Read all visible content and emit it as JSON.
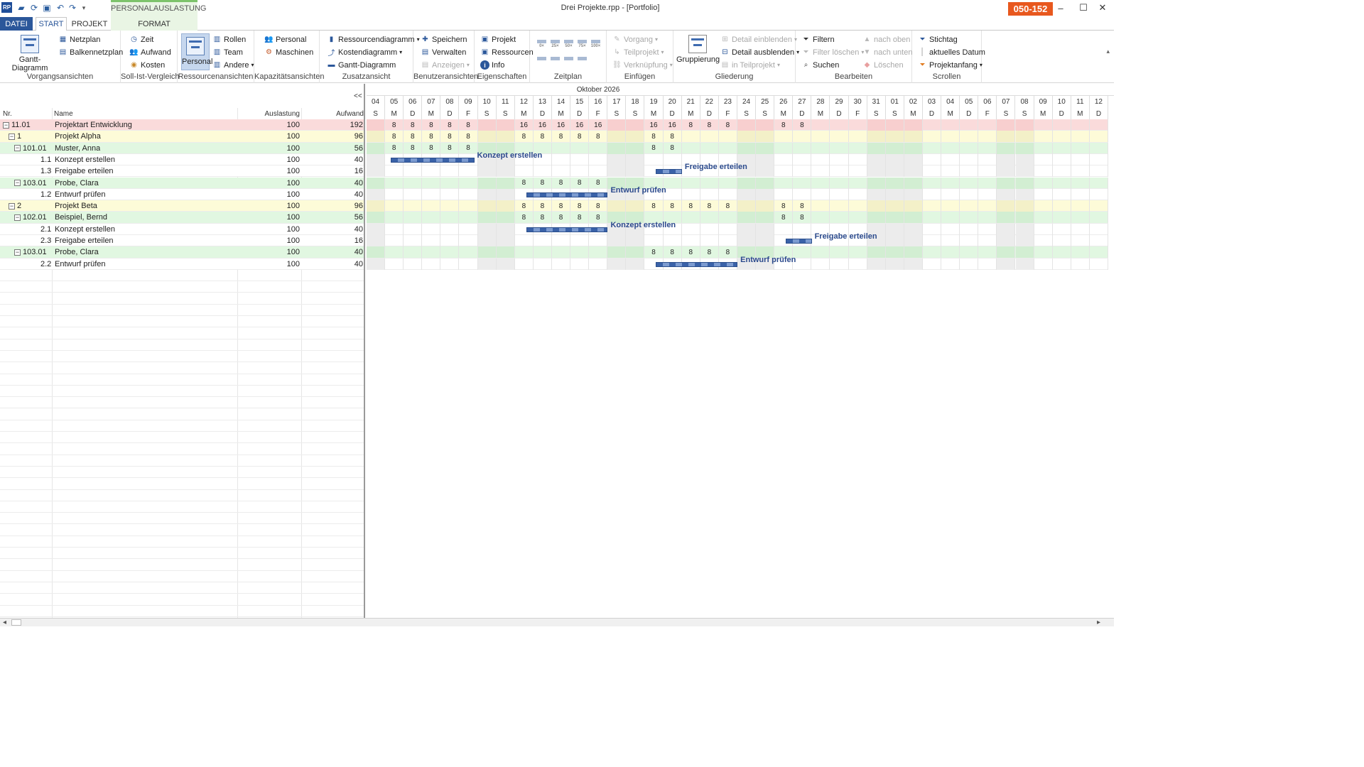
{
  "titlebar": {
    "logo": "RP",
    "window_title": "Drei Projekte.rpp - [Portfolio]",
    "context_group": "PERSONALAUSLASTUNG",
    "license_badge": "050-152",
    "minimize": "–",
    "maximize": "☐",
    "close": "✕"
  },
  "tabs": {
    "datei": "DATEI",
    "start": "START",
    "projekt": "PROJEKT",
    "format": "FORMAT"
  },
  "ribbon": {
    "vorgangsansichten": {
      "label": "Vorgangsansichten",
      "gantt": "Gantt-Diagramm",
      "netzplan": "Netzplan",
      "balkennetzplan": "Balkennetzplan"
    },
    "soll_ist": {
      "label": "Soll-Ist-Vergleich",
      "zeit": "Zeit",
      "aufwand": "Aufwand",
      "kosten": "Kosten"
    },
    "ressourcenansichten": {
      "label": "Ressourcenansichten",
      "personal": "Personal",
      "rollen": "Rollen",
      "team": "Team",
      "andere": "Andere"
    },
    "kapazitaet": {
      "label": "Kapazitätsansichten",
      "personal": "Personal",
      "maschinen": "Maschinen"
    },
    "zusatz": {
      "label": "Zusatzansicht",
      "ressourcendiagramm": "Ressourcendiagramm",
      "kostendiagramm": "Kostendiagramm",
      "gantt": "Gantt-Diagramm"
    },
    "benutzer": {
      "label": "Benutzeransichten",
      "speichern": "Speichern",
      "verwalten": "Verwalten",
      "anzeigen": "Anzeigen"
    },
    "eigenschaften": {
      "label": "Eigenschaften",
      "projekt": "Projekt",
      "ressourcen": "Ressourcen",
      "info": "Info"
    },
    "zeitplan": {
      "label": "Zeitplan",
      "zoom": [
        "0×",
        "25×",
        "50×",
        "75×",
        "100×"
      ]
    },
    "einfuegen": {
      "label": "Einfügen",
      "vorgang": "Vorgang",
      "teilprojekt": "Teilprojekt",
      "verknuepfung": "Verknüpfung"
    },
    "gliederung": {
      "label": "Gliederung",
      "gruppierung": "Gruppierung",
      "detail_ein": "Detail einblenden",
      "detail_aus": "Detail ausblenden",
      "in_teilprojekt": "in Teilprojekt"
    },
    "bearbeiten": {
      "label": "Bearbeiten",
      "filtern": "Filtern",
      "filter_loeschen": "Filter löschen",
      "suchen": "Suchen",
      "nach_oben": "nach oben",
      "nach_unten": "nach unten",
      "loeschen": "Löschen"
    },
    "scrollen": {
      "label": "Scrollen",
      "stichtag": "Stichtag",
      "aktuelles_datum": "aktuelles Datum",
      "projektanfang": "Projektanfang"
    }
  },
  "table": {
    "collapse": "<<",
    "headers": {
      "nr": "Nr.",
      "name": "Name",
      "auslastung": "Auslastung",
      "aufwand": "Aufwand"
    },
    "rows": [
      {
        "nr": "11.01",
        "name": "Projektart Entwicklung",
        "auslastung": "100",
        "aufwand": "192",
        "level": 0,
        "exp": true,
        "type": "root"
      },
      {
        "nr": "1",
        "name": "Projekt Alpha",
        "auslastung": "100",
        "aufwand": "96",
        "level": 1,
        "exp": true,
        "type": "project"
      },
      {
        "nr": "101.01",
        "name": "Muster, Anna",
        "auslastung": "100",
        "aufwand": "56",
        "level": 2,
        "exp": true,
        "type": "resource"
      },
      {
        "nr": "1.1",
        "name": "Konzept erstellen",
        "auslastung": "100",
        "aufwand": "40",
        "level": 3,
        "exp": false,
        "type": "task"
      },
      {
        "nr": "1.3",
        "name": "Freigabe erteilen",
        "auslastung": "100",
        "aufwand": "16",
        "level": 3,
        "exp": false,
        "type": "task"
      },
      {
        "nr": "103.01",
        "name": "Probe, Clara",
        "auslastung": "100",
        "aufwand": "40",
        "level": 2,
        "exp": true,
        "type": "resource"
      },
      {
        "nr": "1.2",
        "name": "Entwurf prüfen",
        "auslastung": "100",
        "aufwand": "40",
        "level": 3,
        "exp": false,
        "type": "task"
      },
      {
        "nr": "2",
        "name": "Projekt Beta",
        "auslastung": "100",
        "aufwand": "96",
        "level": 1,
        "exp": true,
        "type": "project"
      },
      {
        "nr": "102.01",
        "name": "Beispiel, Bernd",
        "auslastung": "100",
        "aufwand": "56",
        "level": 2,
        "exp": true,
        "type": "resource"
      },
      {
        "nr": "2.1",
        "name": "Konzept erstellen",
        "auslastung": "100",
        "aufwand": "40",
        "level": 3,
        "exp": false,
        "type": "task"
      },
      {
        "nr": "2.3",
        "name": "Freigabe erteilen",
        "auslastung": "100",
        "aufwand": "16",
        "level": 3,
        "exp": false,
        "type": "task"
      },
      {
        "nr": "103.01",
        "name": "Probe, Clara",
        "auslastung": "100",
        "aufwand": "40",
        "level": 2,
        "exp": true,
        "type": "resource"
      },
      {
        "nr": "2.2",
        "name": "Entwurf prüfen",
        "auslastung": "100",
        "aufwand": "40",
        "level": 3,
        "exp": false,
        "type": "task"
      }
    ]
  },
  "timeline": {
    "month": "Oktober 2026",
    "days": [
      "04",
      "05",
      "06",
      "07",
      "08",
      "09",
      "10",
      "11",
      "12",
      "13",
      "14",
      "15",
      "16",
      "17",
      "18",
      "19",
      "20",
      "21",
      "22",
      "23",
      "24",
      "25",
      "26",
      "27",
      "28",
      "29",
      "30",
      "31",
      "01",
      "02",
      "03",
      "04",
      "05",
      "06",
      "07",
      "08",
      "09",
      "10",
      "11",
      "12"
    ],
    "weekdays": [
      "S",
      "M",
      "D",
      "M",
      "D",
      "F",
      "S",
      "S",
      "M",
      "D",
      "M",
      "D",
      "F",
      "S",
      "S",
      "M",
      "D",
      "M",
      "D",
      "F",
      "S",
      "S",
      "M",
      "D",
      "M",
      "D",
      "F",
      "S",
      "S",
      "M",
      "D",
      "M",
      "D",
      "F",
      "S",
      "S",
      "M",
      "D",
      "M",
      "D"
    ],
    "values": {
      "0": [
        "",
        "8",
        "8",
        "8",
        "8",
        "8",
        "",
        "",
        "16",
        "16",
        "16",
        "16",
        "16",
        "",
        "",
        "16",
        "16",
        "8",
        "8",
        "8",
        "",
        "",
        "8",
        "8"
      ],
      "1": [
        "",
        "8",
        "8",
        "8",
        "8",
        "8",
        "",
        "",
        "8",
        "8",
        "8",
        "8",
        "8",
        "",
        "",
        "8",
        "8"
      ],
      "2": [
        "",
        "8",
        "8",
        "8",
        "8",
        "8",
        "",
        "",
        "",
        "",
        "",
        "",
        "",
        "",
        "",
        "8",
        "8"
      ],
      "5": [
        "",
        "",
        "",
        "",
        "",
        "",
        "",
        "",
        "8",
        "8",
        "8",
        "8",
        "8"
      ],
      "7": [
        "",
        "",
        "",
        "",
        "",
        "",
        "",
        "",
        "8",
        "8",
        "8",
        "8",
        "8",
        "",
        "",
        "8",
        "8",
        "8",
        "8",
        "8",
        "",
        "",
        "8",
        "8"
      ],
      "8": [
        "",
        "",
        "",
        "",
        "",
        "",
        "",
        "",
        "8",
        "8",
        "8",
        "8",
        "8",
        "",
        "",
        "",
        "",
        "",
        "",
        "",
        "",
        "",
        "8",
        "8"
      ],
      "11": [
        "",
        "",
        "",
        "",
        "",
        "",
        "",
        "",
        "",
        "",
        "",
        "",
        "",
        "",
        "",
        "8",
        "8",
        "8",
        "8",
        "8"
      ]
    },
    "bars": [
      {
        "row": 3,
        "start": 1,
        "end": 5.5,
        "label": "Konzept erstellen"
      },
      {
        "row": 4,
        "start": 15.3,
        "end": 16.7,
        "label": "Freigabe erteilen"
      },
      {
        "row": 6,
        "start": 8.3,
        "end": 12.7,
        "label": "Entwurf prüfen"
      },
      {
        "row": 9,
        "start": 8.3,
        "end": 12.7,
        "label": "Konzept erstellen"
      },
      {
        "row": 10,
        "start": 22.3,
        "end": 23.7,
        "label": "Freigabe erteilen"
      },
      {
        "row": 12,
        "start": 15.3,
        "end": 19.7,
        "label": "Entwurf prüfen"
      }
    ]
  },
  "scroll": {
    "left": "◂",
    "right": "▸"
  }
}
